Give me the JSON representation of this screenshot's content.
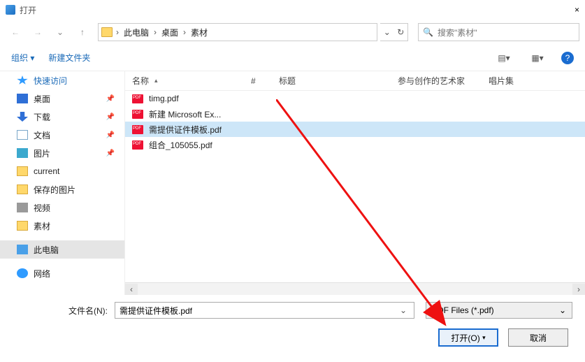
{
  "window": {
    "title": "打开",
    "close_glyph": "×"
  },
  "nav": {
    "back_glyph": "←",
    "fwd_glyph": "→",
    "up_glyph": "↑",
    "breadcrumb": [
      "此电脑",
      "桌面",
      "素材"
    ],
    "sep": "›",
    "refresh_glyph": "↻",
    "dropdown_glyph": "⌄"
  },
  "search": {
    "icon": "🔍",
    "placeholder": "搜索\"素材\""
  },
  "toolbar": {
    "organize": "组织 ▾",
    "newfolder": "新建文件夹",
    "view1": "▤▾",
    "view2": "▦▾",
    "help": "?"
  },
  "sidebar": {
    "quick": "快速访问",
    "items": [
      {
        "label": "桌面",
        "pin": true
      },
      {
        "label": "下载",
        "pin": true
      },
      {
        "label": "文档",
        "pin": true
      },
      {
        "label": "图片",
        "pin": true
      },
      {
        "label": "current",
        "pin": false
      },
      {
        "label": "保存的图片",
        "pin": false
      },
      {
        "label": "视频",
        "pin": false
      },
      {
        "label": "素材",
        "pin": false
      }
    ],
    "thispc": "此电脑",
    "network": "网络"
  },
  "columns": {
    "name": "名称",
    "num": "#",
    "topic": "标题",
    "artist": "参与创作的艺术家",
    "album": "唱片集"
  },
  "files": [
    {
      "name": "timg.pdf",
      "selected": false
    },
    {
      "name": "新建 Microsoft Ex...",
      "selected": false
    },
    {
      "name": "需提供证件模板.pdf",
      "selected": true
    },
    {
      "name": "组合_105055.pdf",
      "selected": false
    }
  ],
  "footer": {
    "filename_label": "文件名(N):",
    "filename_value": "需提供证件模板.pdf",
    "filetype": "PDF Files (*.pdf)",
    "open": "打开(O)",
    "cancel": "取消"
  },
  "scroll": {
    "left": "‹",
    "right": "›"
  }
}
